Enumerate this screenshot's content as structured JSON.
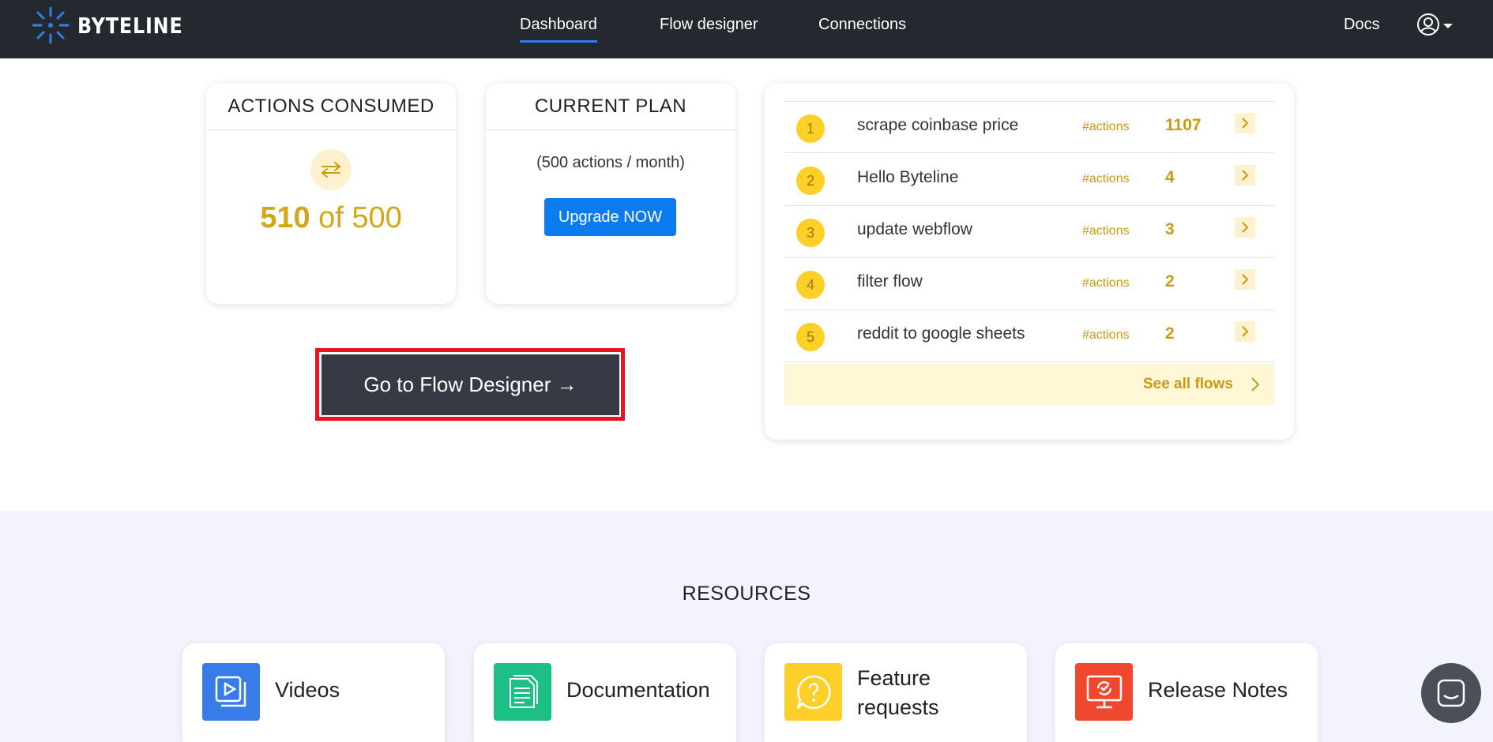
{
  "nav": {
    "logo_text": "BYTELINE",
    "links": [
      "Dashboard",
      "Flow designer",
      "Connections"
    ],
    "docs": "Docs"
  },
  "actions_card": {
    "title": "ACTIONS CONSUMED",
    "used": "510",
    "of_text": " of 500"
  },
  "plan_card": {
    "title": "CURRENT PLAN",
    "description": "(500 actions / month)",
    "upgrade_label": "Upgrade NOW"
  },
  "flow_designer_button": "Go to Flow Designer →",
  "flows": [
    {
      "rank": "1",
      "name": "scrape coinbase price",
      "tag": "#actions",
      "count": "1107"
    },
    {
      "rank": "2",
      "name": "Hello Byteline",
      "tag": "#actions",
      "count": "4"
    },
    {
      "rank": "3",
      "name": "update webflow",
      "tag": "#actions",
      "count": "3"
    },
    {
      "rank": "4",
      "name": "filter flow",
      "tag": "#actions",
      "count": "2"
    },
    {
      "rank": "5",
      "name": "reddit to google sheets",
      "tag": "#actions",
      "count": "2"
    }
  ],
  "see_all_label": "See all flows",
  "resources": {
    "title": "RESOURCES",
    "cards": [
      {
        "label": "Videos",
        "icon": "video-icon",
        "color": "#3a7bea"
      },
      {
        "label": "Documentation",
        "icon": "document-icon",
        "color": "#1dbf84"
      },
      {
        "label_line1": "Feature",
        "label_line2": "requests",
        "icon": "question-bubble-icon",
        "color": "#fcd029"
      },
      {
        "label": "Release Notes",
        "icon": "monitor-refresh-icon",
        "color": "#f0482f"
      }
    ]
  },
  "colors": {
    "navbar": "#24282f",
    "accent_gold": "#c99a13",
    "primary_blue": "#0a7cf0",
    "highlight_red": "#e8151f"
  }
}
